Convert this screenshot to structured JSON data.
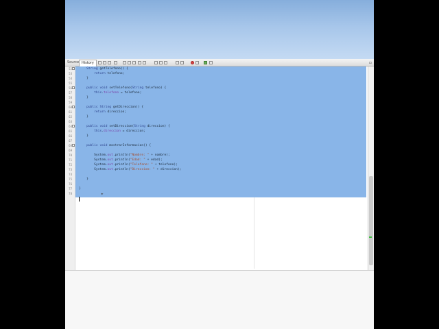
{
  "toolbar": {
    "tabs": [
      {
        "label": "Source"
      },
      {
        "label": "History"
      }
    ],
    "icons": [
      "back-icon",
      "forward-icon",
      "toggle-icon",
      "find-icon",
      "prev-icon",
      "next-icon",
      "select-icon",
      "shift-left-icon",
      "shift-right-icon",
      "comment-icon",
      "uncomment-icon",
      "record-macro-icon",
      "stop-macro-icon",
      "run-icon",
      "debug-icon"
    ],
    "close_glyph": "▫"
  },
  "editor": {
    "lines": [
      {
        "num": "52",
        "text": "    String getTelefono() {"
      },
      {
        "num": "53",
        "text": "        return telefono;"
      },
      {
        "num": "54",
        "text": "    }"
      },
      {
        "num": "55",
        "text": ""
      },
      {
        "num": "56",
        "text": "    public void setTelefono(String telefono) {"
      },
      {
        "num": "57",
        "text": "        this.telefono = telefono;"
      },
      {
        "num": "58",
        "text": "    }"
      },
      {
        "num": "59",
        "text": ""
      },
      {
        "num": "60",
        "text": "    public String getDireccion() {"
      },
      {
        "num": "61",
        "text": "        return direccion;"
      },
      {
        "num": "62",
        "text": "    }"
      },
      {
        "num": "63",
        "text": ""
      },
      {
        "num": "64",
        "text": "    public void setDireccion(String direccion) {"
      },
      {
        "num": "65",
        "text": "        this.direccion = direccion;"
      },
      {
        "num": "66",
        "text": "    }"
      },
      {
        "num": "67",
        "text": ""
      },
      {
        "num": "68",
        "text": "    public void mostrarInformacion() {"
      },
      {
        "num": "69",
        "text": ""
      },
      {
        "num": "70",
        "text": "        System.out.println(\"Nombre: \" + nombre);"
      },
      {
        "num": "71",
        "text": "        System.out.println(\"Edad: \" + edad);"
      },
      {
        "num": "72",
        "text": "        System.out.println(\"Telefono: \" + telefono);"
      },
      {
        "num": "73",
        "text": "        System.out.println(\"Direccion: \" + direccion);"
      },
      {
        "num": "74",
        "text": ""
      },
      {
        "num": "75",
        "text": "    }"
      },
      {
        "num": "76",
        "text": ""
      },
      {
        "num": "77",
        "text": "}"
      },
      {
        "num": "78",
        "text": ""
      }
    ],
    "colors": {
      "selection": "#89b5e8",
      "keyword": "#2a3f8a",
      "field": "#7b3fa8",
      "string": "#a44a2a"
    }
  }
}
